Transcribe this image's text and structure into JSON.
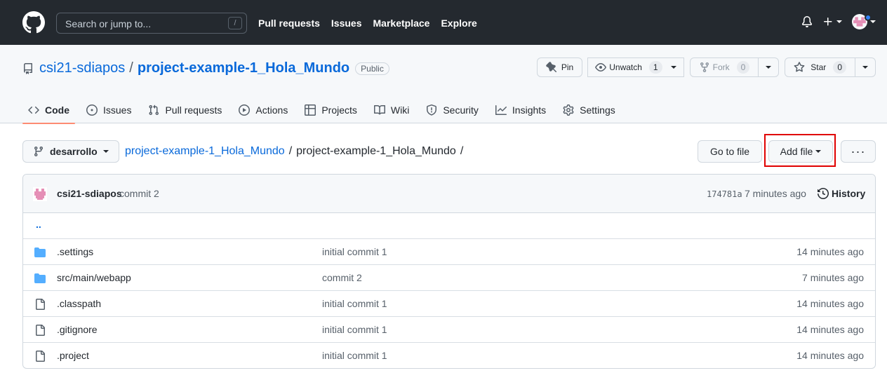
{
  "header": {
    "search_placeholder": "Search or jump to...",
    "search_key": "/",
    "nav": [
      "Pull requests",
      "Issues",
      "Marketplace",
      "Explore"
    ]
  },
  "repo": {
    "owner": "csi21-sdiapos",
    "separator": "/",
    "name": "project-example-1_Hola_Mundo",
    "visibility": "Public",
    "pin_label": "Pin",
    "unwatch_label": "Unwatch",
    "unwatch_count": "1",
    "fork_label": "Fork",
    "fork_count": "0",
    "star_label": "Star",
    "star_count": "0"
  },
  "tabs": [
    {
      "label": "Code",
      "icon": "code-icon"
    },
    {
      "label": "Issues",
      "icon": "issue-icon"
    },
    {
      "label": "Pull requests",
      "icon": "pull-request-icon"
    },
    {
      "label": "Actions",
      "icon": "play-icon"
    },
    {
      "label": "Projects",
      "icon": "table-icon"
    },
    {
      "label": "Wiki",
      "icon": "book-icon"
    },
    {
      "label": "Security",
      "icon": "shield-icon"
    },
    {
      "label": "Insights",
      "icon": "graph-icon"
    },
    {
      "label": "Settings",
      "icon": "gear-icon"
    }
  ],
  "filenav": {
    "branch": "desarrollo",
    "crumb_root": "project-example-1_Hola_Mundo",
    "crumb_sep": "/",
    "crumb_current": "project-example-1_Hola_Mundo",
    "crumb_trailing": "/",
    "goto_label": "Go to file",
    "addfile_label": "Add file",
    "more_label": "···"
  },
  "commit": {
    "author": "csi21-sdiapos",
    "message": "commit 2",
    "sha": "174781a",
    "time": "7 minutes ago",
    "history_label": "History"
  },
  "files": {
    "up": "..",
    "rows": [
      {
        "type": "dir",
        "name": ".settings",
        "message": "initial commit 1",
        "age": "14 minutes ago"
      },
      {
        "type": "dir",
        "name": "src/main/webapp",
        "message": "commit 2",
        "age": "7 minutes ago"
      },
      {
        "type": "file",
        "name": ".classpath",
        "message": "initial commit 1",
        "age": "14 minutes ago"
      },
      {
        "type": "file",
        "name": ".gitignore",
        "message": "initial commit 1",
        "age": "14 minutes ago"
      },
      {
        "type": "file",
        "name": ".project",
        "message": "initial commit 1",
        "age": "14 minutes ago"
      }
    ]
  },
  "colors": {
    "header_bg": "#24292f",
    "link": "#0969da",
    "folder": "#54aeff",
    "active_tab_underline": "#fd8c73",
    "highlight_box": "#e00000"
  }
}
